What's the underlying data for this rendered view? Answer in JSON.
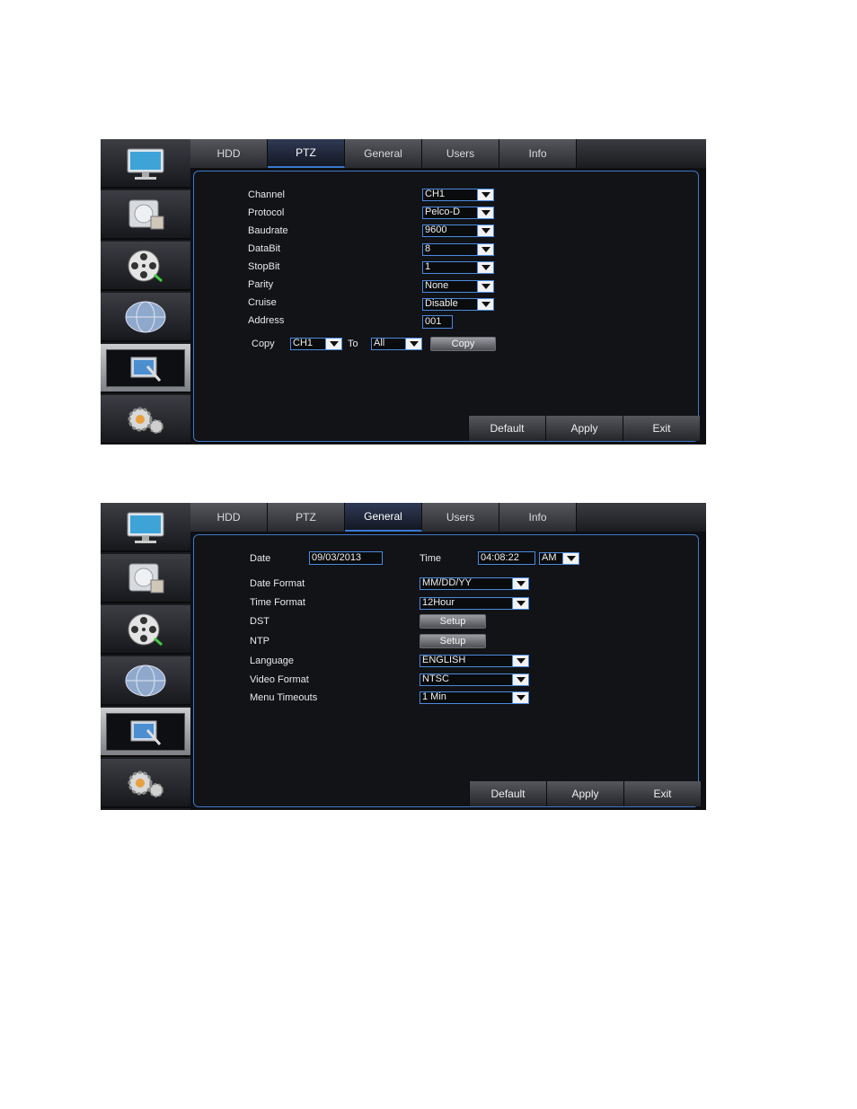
{
  "sidebar": {
    "items": [
      {
        "icon": "monitor-icon"
      },
      {
        "icon": "hdd-record-icon"
      },
      {
        "icon": "film-reel-icon"
      },
      {
        "icon": "network-globe-icon"
      },
      {
        "icon": "system-tools-icon"
      },
      {
        "icon": "gears-icon"
      }
    ],
    "active_index": 4
  },
  "tabs": [
    "HDD",
    "PTZ",
    "General",
    "Users",
    "Info"
  ],
  "ptz": {
    "active_tab": "PTZ",
    "fields": {
      "channel": {
        "label": "Channel",
        "value": "CH1"
      },
      "protocol": {
        "label": "Protocol",
        "value": "Pelco-D"
      },
      "baudrate": {
        "label": "Baudrate",
        "value": "9600"
      },
      "databit": {
        "label": "DataBit",
        "value": "8"
      },
      "stopbit": {
        "label": "StopBit",
        "value": "1"
      },
      "parity": {
        "label": "Parity",
        "value": "None"
      },
      "cruise": {
        "label": "Cruise",
        "value": "Disable"
      },
      "address": {
        "label": "Address",
        "value": "001"
      }
    },
    "copy": {
      "label": "Copy",
      "from": "CH1",
      "to_label": "To",
      "to": "All",
      "button": "Copy"
    }
  },
  "general": {
    "active_tab": "General",
    "date": {
      "label": "Date",
      "value": "09/03/2013"
    },
    "time": {
      "label": "Time",
      "value": "04:08:22",
      "ampm": "AM"
    },
    "date_format": {
      "label": "Date Format",
      "value": "MM/DD/YY"
    },
    "time_format": {
      "label": "Time Format",
      "value": "12Hour"
    },
    "dst": {
      "label": "DST",
      "button": "Setup"
    },
    "ntp": {
      "label": "NTP",
      "button": "Setup"
    },
    "language": {
      "label": "Language",
      "value": "ENGLISH"
    },
    "video_format": {
      "label": "Video Format",
      "value": "NTSC"
    },
    "menu_timeouts": {
      "label": "Menu Timeouts",
      "value": "1 Min"
    }
  },
  "footer": {
    "default": "Default",
    "apply": "Apply",
    "exit": "Exit"
  },
  "colors": {
    "accent": "#3f78c8",
    "background": "#0e0f12"
  }
}
